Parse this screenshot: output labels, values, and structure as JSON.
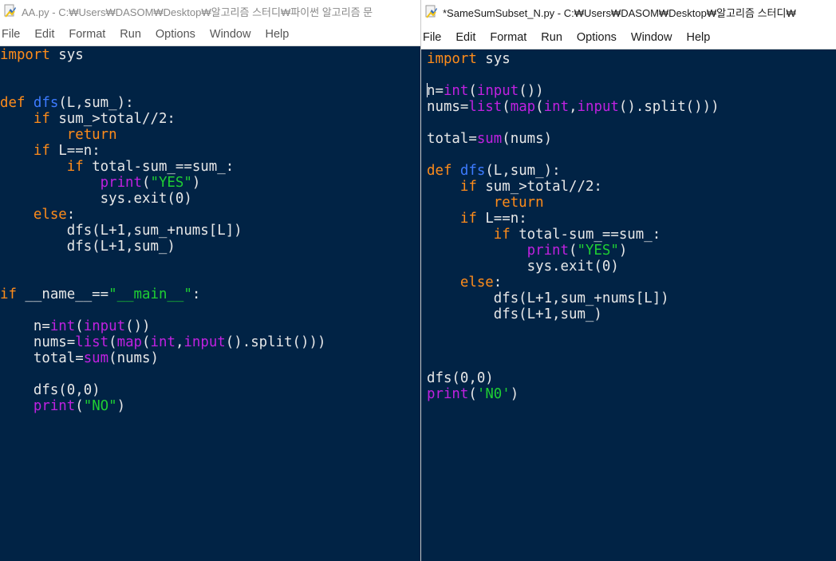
{
  "left_window": {
    "title": "AA.py - C:₩Users₩DASOM₩Desktop₩알고리즘 스터디₩파이썬 알고리즘 문",
    "menu": [
      "File",
      "Edit",
      "Format",
      "Run",
      "Options",
      "Window",
      "Help"
    ],
    "code_lines": [
      [
        {
          "t": "import",
          "c": "kw"
        },
        {
          "t": " sys",
          "c": "df"
        }
      ],
      [],
      [],
      [
        {
          "t": "def ",
          "c": "kw"
        },
        {
          "t": "dfs",
          "c": "fn"
        },
        {
          "t": "(L,sum_):",
          "c": "df"
        }
      ],
      [
        {
          "t": "    ",
          "c": "df"
        },
        {
          "t": "if",
          "c": "kw"
        },
        {
          "t": " sum_>total//2:",
          "c": "df"
        }
      ],
      [
        {
          "t": "        ",
          "c": "df"
        },
        {
          "t": "return",
          "c": "kw"
        }
      ],
      [
        {
          "t": "    ",
          "c": "df"
        },
        {
          "t": "if",
          "c": "kw"
        },
        {
          "t": " L==n:",
          "c": "df"
        }
      ],
      [
        {
          "t": "        ",
          "c": "df"
        },
        {
          "t": "if",
          "c": "kw"
        },
        {
          "t": " total-sum_==sum_:",
          "c": "df"
        }
      ],
      [
        {
          "t": "            ",
          "c": "df"
        },
        {
          "t": "print",
          "c": "bi"
        },
        {
          "t": "(",
          "c": "df"
        },
        {
          "t": "\"YES\"",
          "c": "st"
        },
        {
          "t": ")",
          "c": "df"
        }
      ],
      [
        {
          "t": "            sys.exit(0)",
          "c": "df"
        }
      ],
      [
        {
          "t": "    ",
          "c": "df"
        },
        {
          "t": "else",
          "c": "kw"
        },
        {
          "t": ":",
          "c": "df"
        }
      ],
      [
        {
          "t": "        dfs(L+1,sum_+nums[L])",
          "c": "df"
        }
      ],
      [
        {
          "t": "        dfs(L+1,sum_)",
          "c": "df"
        }
      ],
      [],
      [],
      [
        {
          "t": "if",
          "c": "kw"
        },
        {
          "t": " __name__==",
          "c": "df"
        },
        {
          "t": "\"__main__\"",
          "c": "st"
        },
        {
          "t": ":",
          "c": "df"
        }
      ],
      [],
      [
        {
          "t": "    n=",
          "c": "df"
        },
        {
          "t": "int",
          "c": "bi"
        },
        {
          "t": "(",
          "c": "df"
        },
        {
          "t": "input",
          "c": "bi"
        },
        {
          "t": "())",
          "c": "df"
        }
      ],
      [
        {
          "t": "    nums=",
          "c": "df"
        },
        {
          "t": "list",
          "c": "bi"
        },
        {
          "t": "(",
          "c": "df"
        },
        {
          "t": "map",
          "c": "bi"
        },
        {
          "t": "(",
          "c": "df"
        },
        {
          "t": "int",
          "c": "bi"
        },
        {
          "t": ",",
          "c": "df"
        },
        {
          "t": "input",
          "c": "bi"
        },
        {
          "t": "().split()))",
          "c": "df"
        }
      ],
      [
        {
          "t": "    total=",
          "c": "df"
        },
        {
          "t": "sum",
          "c": "bi"
        },
        {
          "t": "(nums)",
          "c": "df"
        }
      ],
      [],
      [
        {
          "t": "    dfs(0,0)",
          "c": "df"
        }
      ],
      [
        {
          "t": "    ",
          "c": "df"
        },
        {
          "t": "print",
          "c": "bi"
        },
        {
          "t": "(",
          "c": "df"
        },
        {
          "t": "\"NO\"",
          "c": "st"
        },
        {
          "t": ")",
          "c": "df"
        }
      ]
    ]
  },
  "right_window": {
    "title": "*SameSumSubset_N.py - C:₩Users₩DASOM₩Desktop₩알고리즘 스터디₩",
    "menu": [
      "File",
      "Edit",
      "Format",
      "Run",
      "Options",
      "Window",
      "Help"
    ],
    "code_lines": [
      [
        {
          "t": "import",
          "c": "kw"
        },
        {
          "t": " sys",
          "c": "df"
        }
      ],
      [],
      [
        {
          "t": "CARET",
          "c": "caret"
        },
        {
          "t": "n=",
          "c": "df"
        },
        {
          "t": "int",
          "c": "bi"
        },
        {
          "t": "(",
          "c": "df"
        },
        {
          "t": "input",
          "c": "bi"
        },
        {
          "t": "())",
          "c": "df"
        }
      ],
      [
        {
          "t": "nums=",
          "c": "df"
        },
        {
          "t": "list",
          "c": "bi"
        },
        {
          "t": "(",
          "c": "df"
        },
        {
          "t": "map",
          "c": "bi"
        },
        {
          "t": "(",
          "c": "df"
        },
        {
          "t": "int",
          "c": "bi"
        },
        {
          "t": ",",
          "c": "df"
        },
        {
          "t": "input",
          "c": "bi"
        },
        {
          "t": "().split()))",
          "c": "df"
        }
      ],
      [],
      [
        {
          "t": "total=",
          "c": "df"
        },
        {
          "t": "sum",
          "c": "bi"
        },
        {
          "t": "(nums)",
          "c": "df"
        }
      ],
      [],
      [
        {
          "t": "def ",
          "c": "kw"
        },
        {
          "t": "dfs",
          "c": "fn"
        },
        {
          "t": "(L,sum_):",
          "c": "df"
        }
      ],
      [
        {
          "t": "    ",
          "c": "df"
        },
        {
          "t": "if",
          "c": "kw"
        },
        {
          "t": " sum_>total//2:",
          "c": "df"
        }
      ],
      [
        {
          "t": "        ",
          "c": "df"
        },
        {
          "t": "return",
          "c": "kw"
        }
      ],
      [
        {
          "t": "    ",
          "c": "df"
        },
        {
          "t": "if",
          "c": "kw"
        },
        {
          "t": " L==n:",
          "c": "df"
        }
      ],
      [
        {
          "t": "        ",
          "c": "df"
        },
        {
          "t": "if",
          "c": "kw"
        },
        {
          "t": " total-sum_==sum_:",
          "c": "df"
        }
      ],
      [
        {
          "t": "            ",
          "c": "df"
        },
        {
          "t": "print",
          "c": "bi"
        },
        {
          "t": "(",
          "c": "df"
        },
        {
          "t": "\"YES\"",
          "c": "st"
        },
        {
          "t": ")",
          "c": "df"
        }
      ],
      [
        {
          "t": "            sys.exit(0)",
          "c": "df"
        }
      ],
      [
        {
          "t": "    ",
          "c": "df"
        },
        {
          "t": "else",
          "c": "kw"
        },
        {
          "t": ":",
          "c": "df"
        }
      ],
      [
        {
          "t": "        dfs(L+1,sum_+nums[L])",
          "c": "df"
        }
      ],
      [
        {
          "t": "        dfs(L+1,sum_)",
          "c": "df"
        }
      ],
      [],
      [],
      [],
      [
        {
          "t": "dfs(0,0)",
          "c": "df"
        }
      ],
      [
        {
          "t": "print",
          "c": "bi"
        },
        {
          "t": "(",
          "c": "df"
        },
        {
          "t": "'N0'",
          "c": "st"
        },
        {
          "t": ")",
          "c": "df"
        }
      ]
    ]
  },
  "colors": {
    "editor_bg": "#012345",
    "keyword": "#ff8c1a",
    "function_def": "#3d7bff",
    "builtin": "#c021e0",
    "string": "#1fcf33",
    "default_text": "#e8e8e8"
  },
  "icons": {
    "app_icon": "python-file-icon"
  }
}
